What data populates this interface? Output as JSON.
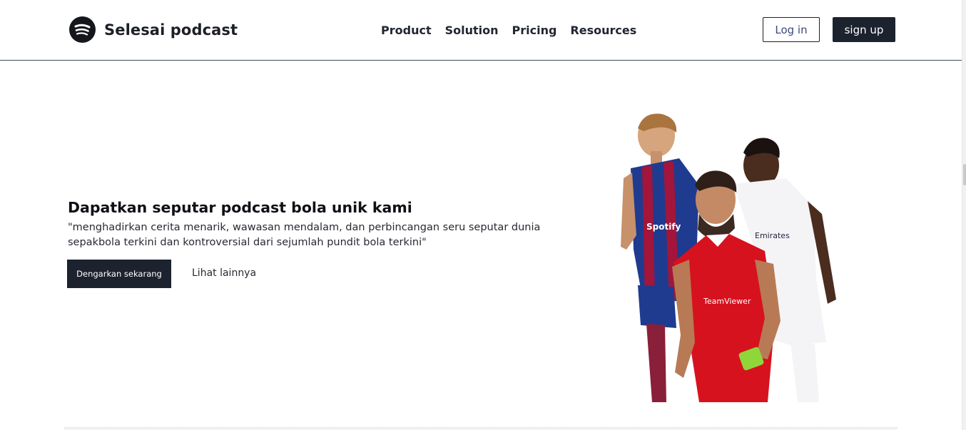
{
  "header": {
    "brand": "Selesai podcast",
    "logo_icon": "spotify-logo-icon",
    "nav": [
      "Product",
      "Solution",
      "Pricing",
      "Resources"
    ],
    "login_label": "Log in",
    "signup_label": "sign up"
  },
  "hero": {
    "title": "Dapatkan seputar podcast bola unik kami",
    "description": "\"menghadirkan cerita menarik, wawasan mendalam, dan perbincangan seru seputar dunia sepakbola terkini dan kontroversial dari sejumlah pundit bola terkini\"",
    "cta_label": "Dengarkan sekarang",
    "more_label": "Lihat lainnya",
    "image_icon": "football-players-image"
  },
  "colors": {
    "primary_dark": "#1c222e",
    "barca_blue": "#1f3b8f",
    "barca_red": "#a3153a",
    "manutd_red": "#d6121f",
    "madrid_white": "#f4f4f7"
  }
}
